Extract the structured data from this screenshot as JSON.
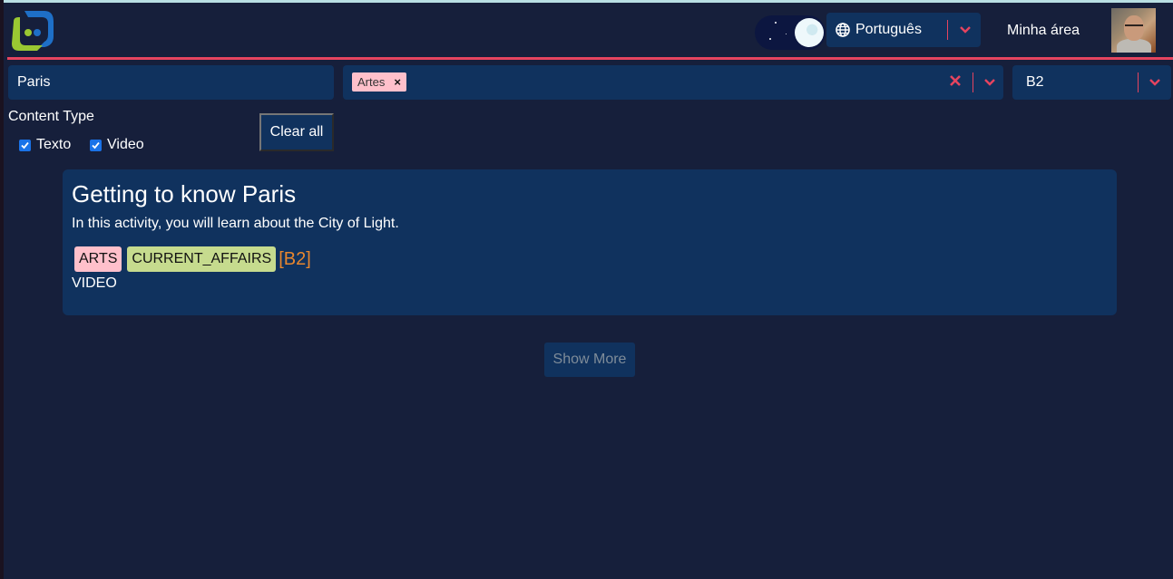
{
  "header": {
    "logo": "app-logo",
    "theme_toggle_mode": "dark",
    "language": {
      "selected": "Português",
      "icon": "globe-icon"
    },
    "my_area_label": "Minha área",
    "avatar": "user-avatar"
  },
  "filters": {
    "search": {
      "value": "Paris",
      "placeholder": ""
    },
    "categories": {
      "selected": [
        {
          "label": "Artes",
          "color": "#ffc0cb"
        }
      ]
    },
    "level": {
      "selected": "B2"
    },
    "content_type": {
      "label": "Content Type",
      "options": [
        {
          "label": "Texto",
          "checked": true
        },
        {
          "label": "Video",
          "checked": true
        }
      ]
    },
    "clear_all_label": "Clear all"
  },
  "results": [
    {
      "title": "Getting to know Paris",
      "description": "In this activity, you will learn about the City of Light.",
      "tags": [
        {
          "label": "ARTS",
          "color": "#ffc0cb"
        },
        {
          "label": "CURRENT_AFFAIRS",
          "color": "#c6db8e"
        }
      ],
      "level": "[B2]",
      "type": "VIDEO"
    }
  ],
  "show_more_label": "Show More",
  "colors": {
    "accent": "#e5445f",
    "panel": "#10325e",
    "background": "#161f3b",
    "level": "#e8862e"
  }
}
